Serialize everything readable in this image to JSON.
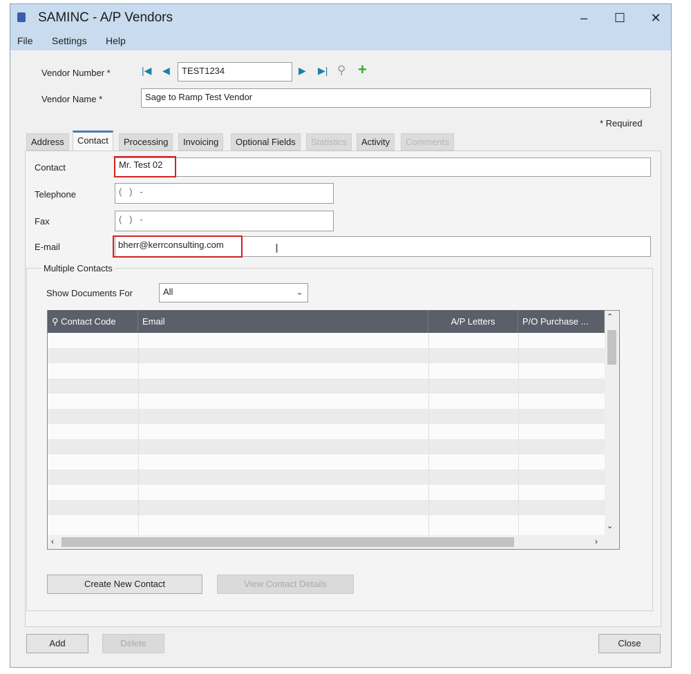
{
  "window": {
    "title": "SAMINC - A/P Vendors",
    "minimize": "–",
    "maximize": "☐",
    "close": "✕"
  },
  "menu": [
    "File",
    "Settings",
    "Help"
  ],
  "header": {
    "vendor_number_label": "Vendor Number *",
    "vendor_number": "TEST1234",
    "vendor_name_label": "Vendor Name *",
    "vendor_name": "Sage to Ramp Test Vendor",
    "required_note": "* Required"
  },
  "tabs": [
    {
      "label": "Address",
      "state": "normal"
    },
    {
      "label": "Contact",
      "state": "active"
    },
    {
      "label": "Processing",
      "state": "normal"
    },
    {
      "label": "Invoicing",
      "state": "normal"
    },
    {
      "label": "Optional Fields",
      "state": "normal"
    },
    {
      "label": "Statistics",
      "state": "disabled"
    },
    {
      "label": "Activity",
      "state": "normal"
    },
    {
      "label": "Comments",
      "state": "disabled"
    }
  ],
  "contact": {
    "contact_label": "Contact",
    "contact": "Mr. Test 02",
    "telephone_label": "Telephone",
    "telephone": "(   )   -",
    "fax_label": "Fax",
    "fax": "(   )   -",
    "email_label": "E-mail",
    "email": "bherr@kerrconsulting.com"
  },
  "multiple": {
    "group_label": "Multiple Contacts",
    "show_label": "Show Documents For",
    "show_value": "All",
    "columns": [
      "Contact Code",
      "Email",
      "A/P Letters",
      "P/O Purchase ..."
    ],
    "create_button": "Create New Contact",
    "view_button": "View Contact Details"
  },
  "footer": {
    "add": "Add",
    "delete": "Delete",
    "close": "Close"
  }
}
